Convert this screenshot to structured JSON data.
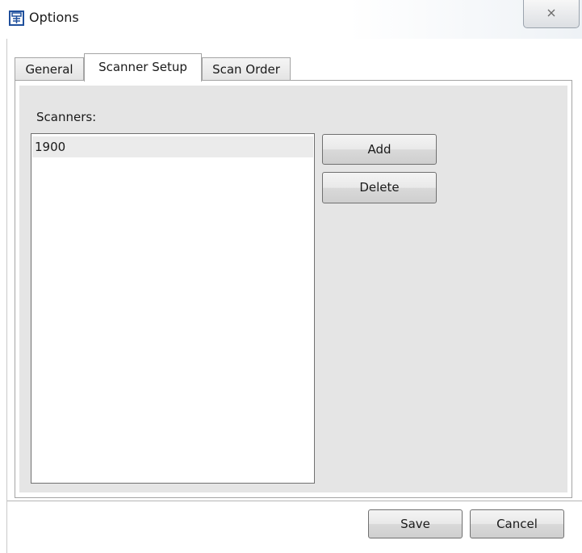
{
  "window": {
    "title": "Options",
    "icon": "options-app-icon",
    "close_icon": "close-icon"
  },
  "tabs": [
    {
      "label": "General",
      "active": false
    },
    {
      "label": "Scanner Setup",
      "active": true
    },
    {
      "label": "Scan Order",
      "active": false
    }
  ],
  "scanner_setup": {
    "scanners_label": "Scanners:",
    "scanners": [
      "1900"
    ],
    "selected_scanner": "1900",
    "add_label": "Add",
    "delete_label": "Delete"
  },
  "footer": {
    "save_label": "Save",
    "cancel_label": "Cancel"
  },
  "colors": {
    "accent_icon": "#1f4f9c",
    "panel_bg": "#e5e5e5",
    "selected_item_bg": "#ebebeb"
  }
}
